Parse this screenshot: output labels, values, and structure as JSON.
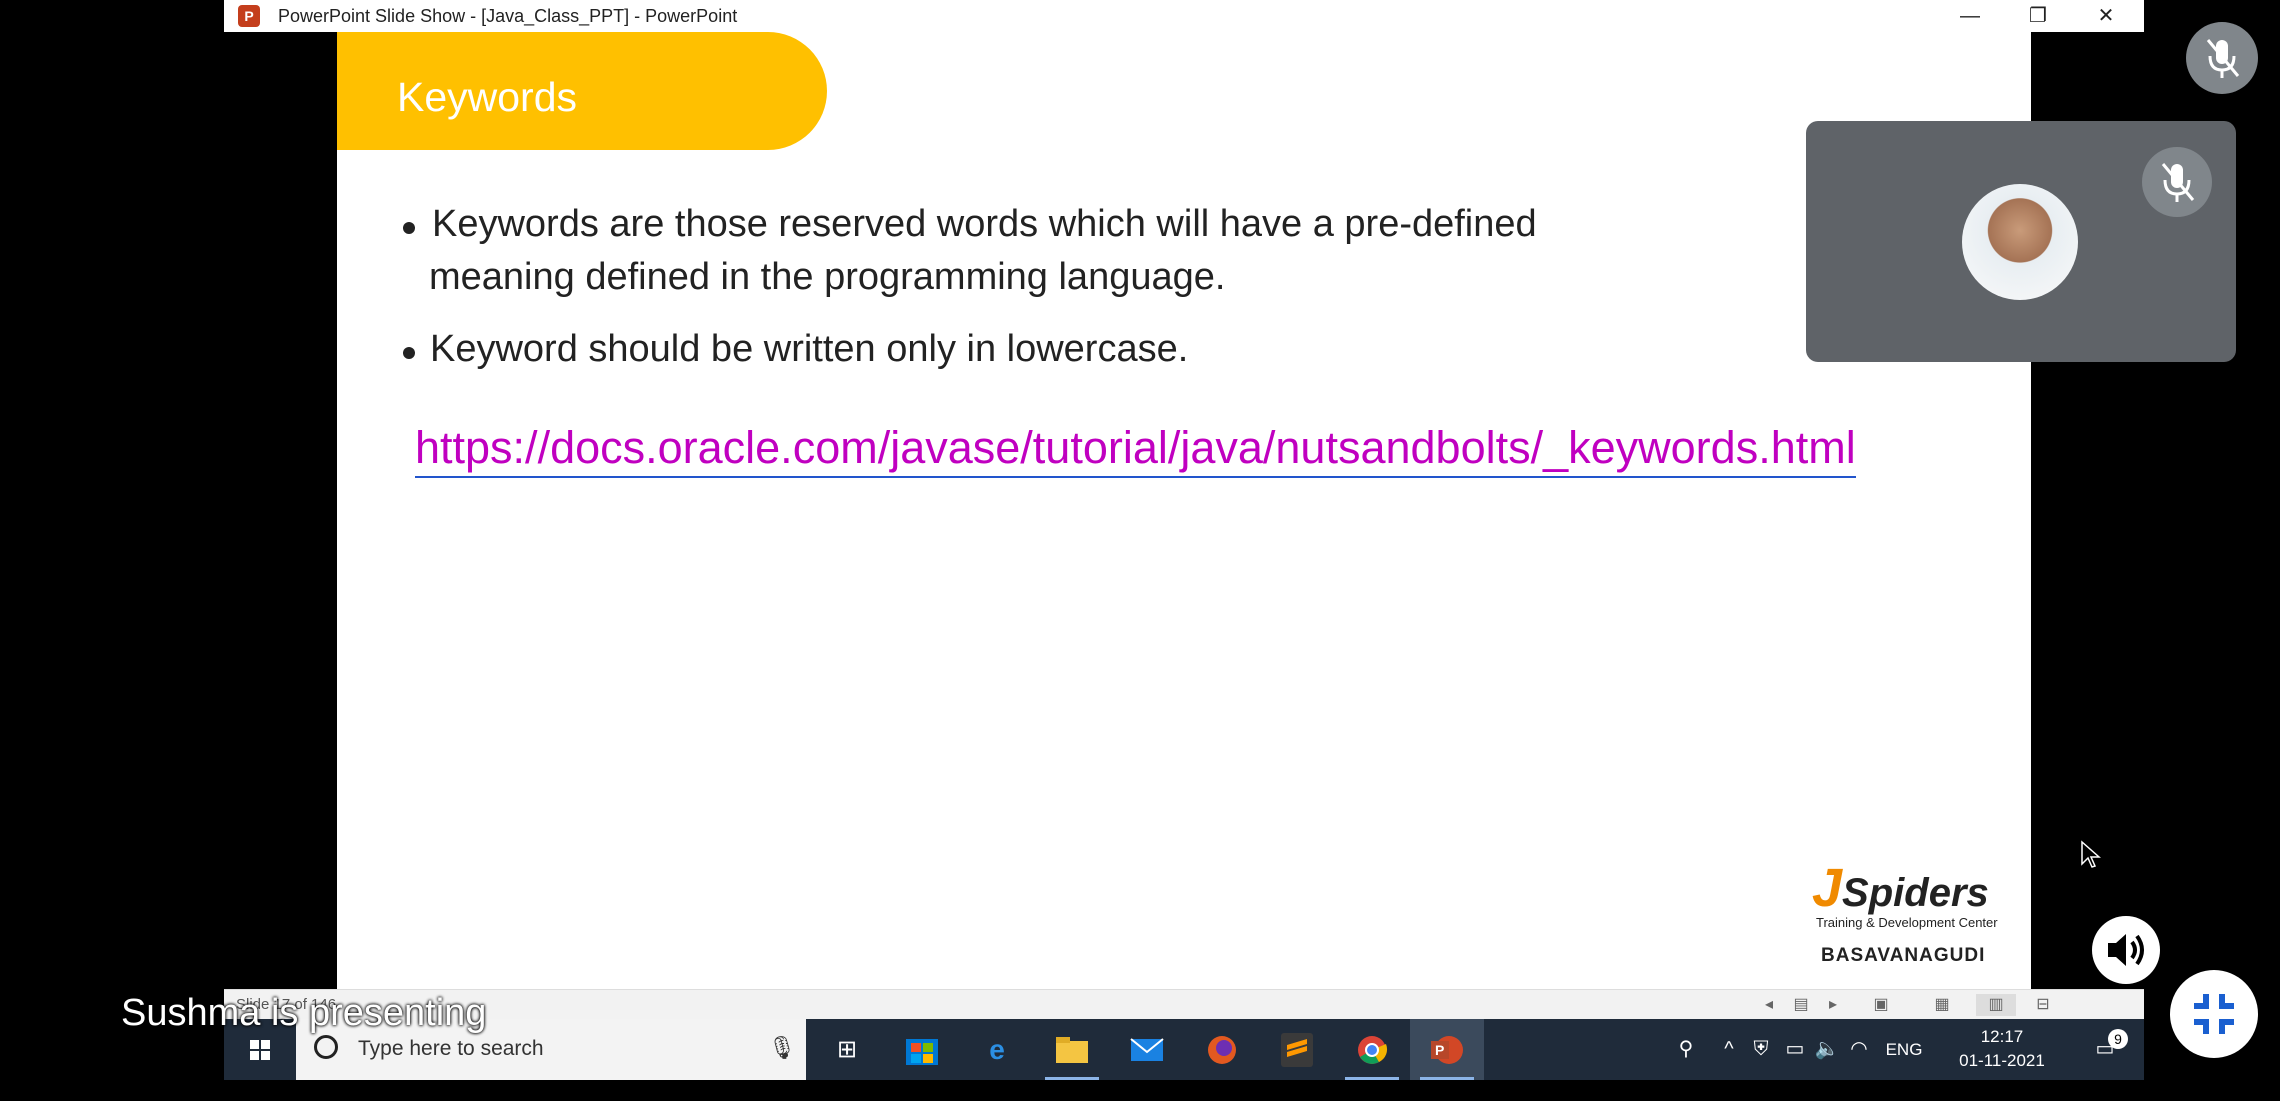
{
  "window": {
    "title": "PowerPoint Slide Show - [Java_Class_PPT] - PowerPoint",
    "app_icon_letter": "P",
    "minimize_glyph": "—",
    "restore_glyph": "❐",
    "close_glyph": "✕"
  },
  "slide": {
    "title": "Keywords",
    "bullets": [
      {
        "line1": "Keywords are those reserved words which will have a pre-defined",
        "line2": "meaning defined in the programming language."
      },
      {
        "line1": "Keyword should be written only in lowercase."
      }
    ],
    "link": "https://docs.oracle.com/javase/tutorial/java/nutsandbolts/_keywords.html",
    "logo": {
      "brand_j": "J",
      "brand_rest": "Spiders",
      "tagline": "Training & Development Center",
      "location": "BASAVANAGUDI"
    }
  },
  "statusbar": {
    "slide_counter": "Slide 17 of 146"
  },
  "taskbar": {
    "search_placeholder": "Type here to search",
    "apps": [
      "task-view",
      "store",
      "edge",
      "file-explorer",
      "mail",
      "firefox",
      "sublime-text",
      "chrome",
      "powerpoint"
    ],
    "language": "ENG",
    "time": "12:17",
    "date": "01-11-2021",
    "notification_count": "9"
  },
  "meeting": {
    "presenter_label": "Sushma is presenting"
  },
  "colors": {
    "title_banner": "#ffc000",
    "link": "#c000c0",
    "taskbar": "#1f2b3a",
    "video_tile": "#5f6368"
  }
}
